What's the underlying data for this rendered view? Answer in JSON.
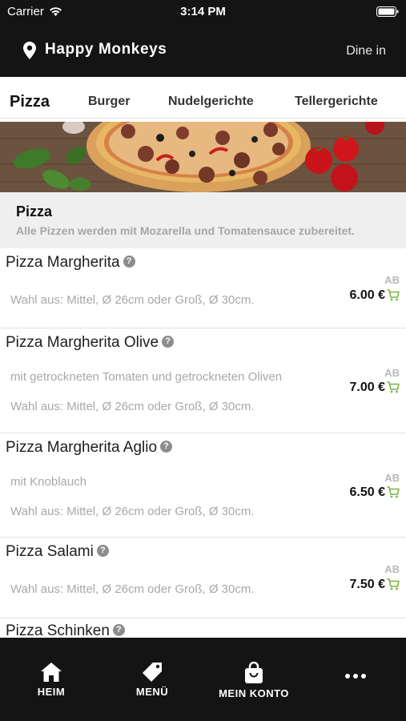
{
  "status_bar": {
    "carrier": "Carrier",
    "time": "3:14 PM"
  },
  "header": {
    "title": "Happy Monkeys",
    "mode": "Dine in"
  },
  "tabs": {
    "items": [
      {
        "label": "Pizza",
        "active": true
      },
      {
        "label": "Burger",
        "active": false
      },
      {
        "label": "Nudelgerichte",
        "active": false
      },
      {
        "label": "Tellergerichte",
        "active": false
      }
    ]
  },
  "section": {
    "title": "Pizza",
    "description": "Alle Pizzen werden mit Mozarella und Tomatensauce zubereitet."
  },
  "products": [
    {
      "name": "Pizza Margherita",
      "descriptions": [
        "Wahl aus: Mittel, Ø 26cm oder Groß, Ø 30cm."
      ],
      "ab": "AB",
      "price": "6.00 €"
    },
    {
      "name": "Pizza Margherita Olive",
      "descriptions": [
        "mit getrockneten Tomaten und getrockneten Oliven",
        "Wahl aus: Mittel, Ø 26cm oder Groß, Ø 30cm."
      ],
      "ab": "AB",
      "price": "7.00 €"
    },
    {
      "name": "Pizza Margherita Aglio",
      "descriptions": [
        "mit Knoblauch",
        "Wahl aus: Mittel, Ø 26cm oder Groß, Ø 30cm."
      ],
      "ab": "AB",
      "price": "6.50 €"
    },
    {
      "name": "Pizza Salami",
      "descriptions": [
        "Wahl aus: Mittel, Ø 26cm oder Groß, Ø 30cm."
      ],
      "ab": "AB",
      "price": "7.50 €"
    },
    {
      "name": "Pizza Schinken",
      "descriptions": [],
      "ab": "",
      "price": ""
    }
  ],
  "bottom_nav": {
    "home": "HEIM",
    "menu": "MENÜ",
    "account": "MEIN KONTO"
  },
  "icons": {
    "location": "location-pin-icon",
    "info": "info-icon",
    "cart": "cart-icon",
    "home": "home-icon",
    "menu": "tag-icon",
    "account": "shopping-bag-icon",
    "more": "more-dots-icon"
  },
  "colors": {
    "accent": "#8bc34a",
    "bar": "#141414"
  }
}
